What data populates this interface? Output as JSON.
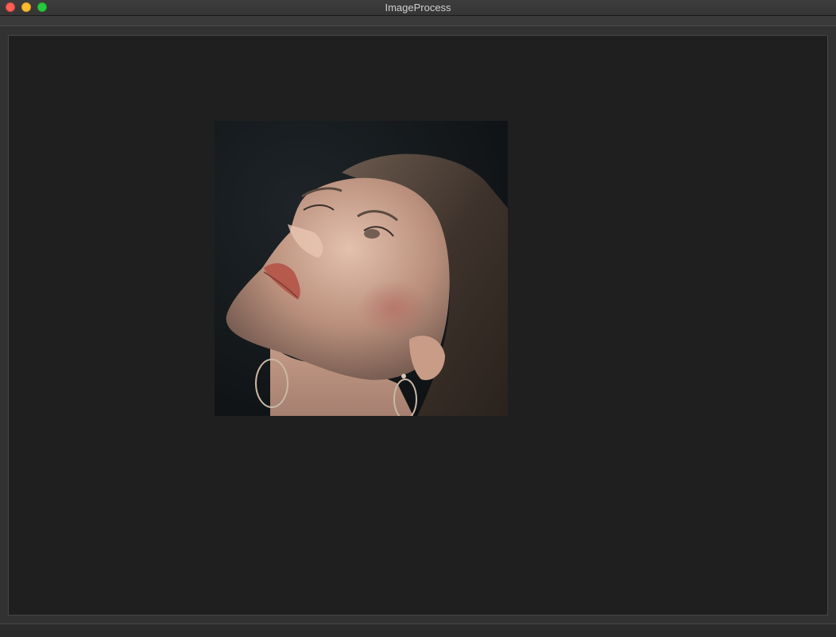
{
  "window": {
    "title": "ImageProcess"
  },
  "colors": {
    "close": "#fe5f57",
    "minimize": "#febb2e",
    "maximize": "#28c840",
    "canvas_background": "#1f1f1f"
  },
  "icons": {
    "close": "close-icon",
    "minimize": "minimize-icon",
    "maximize": "maximize-icon"
  }
}
